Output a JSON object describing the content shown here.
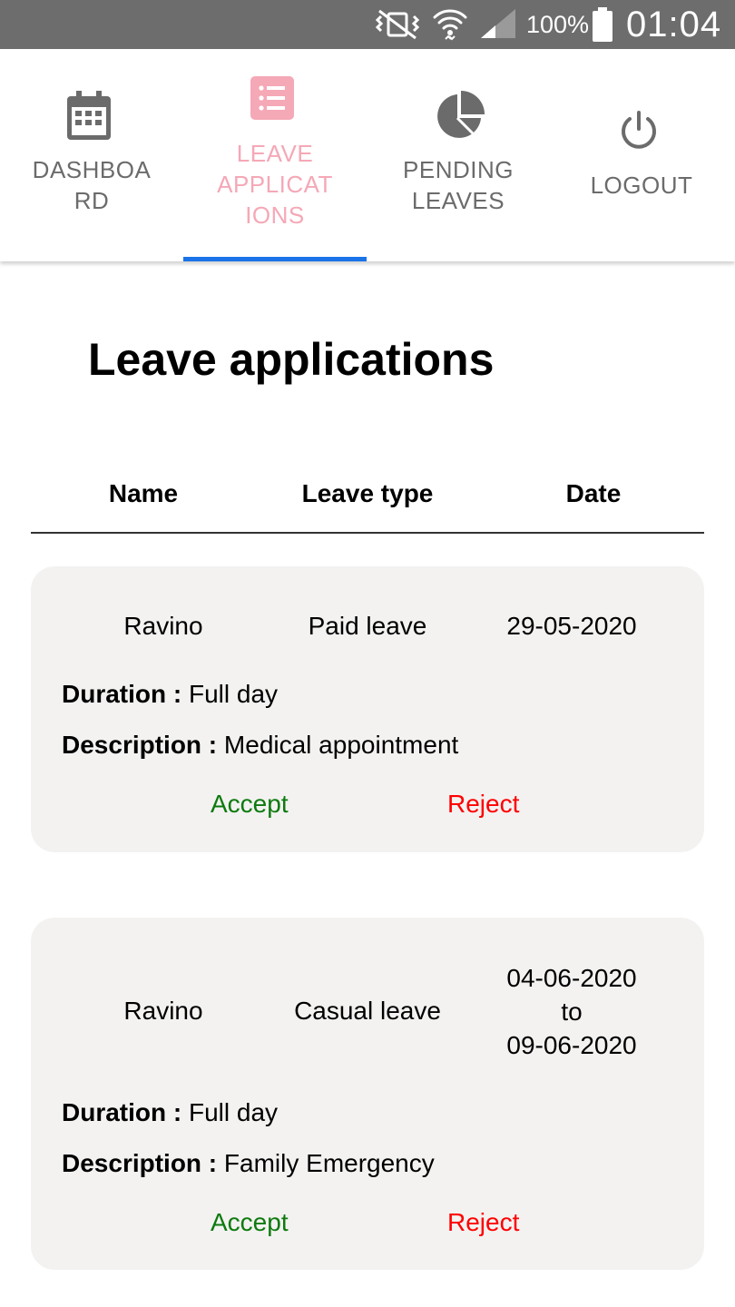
{
  "status_bar": {
    "battery_percent": "100%",
    "clock": "01:04",
    "icons": [
      "vibrate-mute-icon",
      "wifi-icon",
      "signal-icon",
      "battery-icon"
    ]
  },
  "tabs": [
    {
      "label": "DASHBOA\nRD",
      "icon": "calendar-icon",
      "active": false
    },
    {
      "label": "LEAVE\nAPPLICAT\nIONS",
      "icon": "list-icon",
      "active": true
    },
    {
      "label": "PENDING\nLEAVES",
      "icon": "pie-chart-icon",
      "active": false
    },
    {
      "label": "LOGOUT",
      "icon": "power-icon",
      "active": false
    }
  ],
  "colors": {
    "active_tab": "#f5a8b6",
    "indicator": "#1a73e8",
    "accept": "#0e7a0e",
    "reject": "#ff0000",
    "card_bg": "#f3f2f1"
  },
  "page": {
    "title": "Leave applications"
  },
  "table": {
    "headers": {
      "name": "Name",
      "leave_type": "Leave type",
      "date": "Date"
    }
  },
  "applications": [
    {
      "name": "Ravino",
      "leave_type": "Paid leave",
      "date": "29-05-2020",
      "duration_label": "Duration :",
      "duration": "Full day",
      "description_label": "Description :",
      "description": "Medical appointment",
      "accept_label": "Accept",
      "reject_label": "Reject"
    },
    {
      "name": "Ravino",
      "leave_type": "Casual leave",
      "date_from": "04-06-2020",
      "date_to_word": "to",
      "date_to": "09-06-2020",
      "duration_label": "Duration :",
      "duration": "Full day",
      "description_label": "Description :",
      "description": "Family Emergency",
      "accept_label": "Accept",
      "reject_label": "Reject"
    }
  ]
}
